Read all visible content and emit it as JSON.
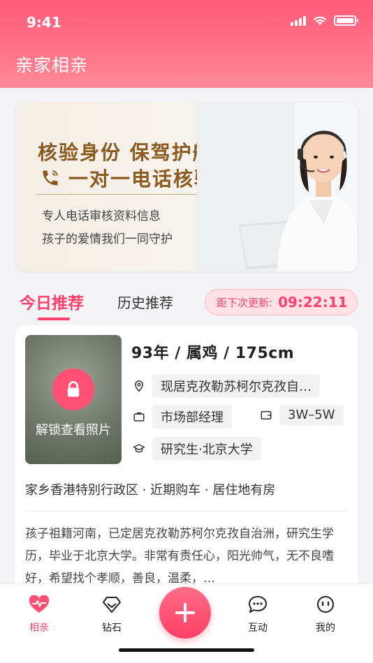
{
  "status_bar": {
    "time": "9:41"
  },
  "header": {
    "title": "亲家相亲"
  },
  "banner": {
    "heading1": "核验身份 保驾护航",
    "heading2": "一对一电话核验",
    "line1": "专人电话审核资料信息",
    "line2": "孩子的爱情我们一同守护"
  },
  "tabs": {
    "today": "今日推荐",
    "history": "历史推荐"
  },
  "countdown": {
    "label": "距下次更新:",
    "value": "09:22:11"
  },
  "profile": {
    "photo_action": "解锁查看照片",
    "headline": "93年 / 属鸡 / 175cm",
    "location": "现居克孜勒苏柯尔克孜自…",
    "job": "市场部经理",
    "income": "3W–5W",
    "education": "研究生·北京大学",
    "tags": "家乡香港特别行政区 · 近期购车 · 居住地有房",
    "description": "孩子祖籍河南，已定居克孜勒苏柯尔克孜自治洲，研究生学历，毕业于北京大学。非常有责任心，阳光帅气，无不良嗜好，希望找个孝顺，善良，温柔，…"
  },
  "tabbar": {
    "items": [
      {
        "label": "相亲",
        "icon": "heart-pulse-icon"
      },
      {
        "label": "钻石",
        "icon": "diamond-icon"
      },
      {
        "label": "",
        "icon": "plus-icon"
      },
      {
        "label": "互动",
        "icon": "chat-icon"
      },
      {
        "label": "我的",
        "icon": "smile-icon"
      }
    ]
  },
  "colors": {
    "brand": "#ff3f6c",
    "banner_gold": "#8b5a1e"
  }
}
